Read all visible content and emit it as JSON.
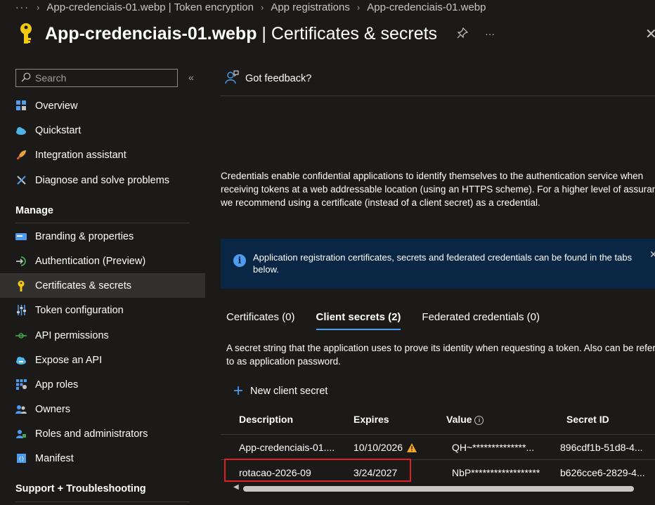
{
  "breadcrumb": {
    "more": "···",
    "items": [
      "App-credenciais-01.webp | Token encryption",
      "App registrations",
      "App-credenciais-01.webp"
    ]
  },
  "header": {
    "title_strong": "App-credenciais-01.webp",
    "title_rest": " | Certificates & secrets",
    "more": "···"
  },
  "sidebar": {
    "search_placeholder": "Search",
    "collapse": "«",
    "items_top": [
      {
        "label": "Overview",
        "icon": "overview-grid-icon"
      },
      {
        "label": "Quickstart",
        "icon": "cloud-quickstart-icon"
      },
      {
        "label": "Integration assistant",
        "icon": "rocket-icon"
      },
      {
        "label": "Diagnose and solve problems",
        "icon": "wrench-icon"
      }
    ],
    "manage_header": "Manage",
    "manage_items": [
      {
        "label": "Branding & properties",
        "icon": "branding-card-icon"
      },
      {
        "label": "Authentication (Preview)",
        "icon": "authentication-icon"
      },
      {
        "label": "Certificates & secrets",
        "icon": "key-icon"
      },
      {
        "label": "Token configuration",
        "icon": "sliders-icon"
      },
      {
        "label": "API permissions",
        "icon": "api-permissions-icon"
      },
      {
        "label": "Expose an API",
        "icon": "cloud-api-icon"
      },
      {
        "label": "App roles",
        "icon": "app-roles-grid-icon"
      },
      {
        "label": "Owners",
        "icon": "owners-people-icon"
      },
      {
        "label": "Roles and administrators",
        "icon": "roles-admins-icon"
      },
      {
        "label": "Manifest",
        "icon": "manifest-icon"
      }
    ],
    "support_header": "Support + Troubleshooting"
  },
  "main": {
    "feedback": "Got feedback?",
    "description": "Credentials enable confidential applications to identify themselves to the authentication service when receiving tokens at a web addressable location (using an HTTPS scheme). For a higher level of assurance, we recommend using a certificate (instead of a client secret) as a credential.",
    "info_banner": "Application registration certificates, secrets and federated credentials can be found in the tabs below.",
    "tabs": [
      "Certificates (0)",
      "Client secrets (2)",
      "Federated credentials (0)"
    ],
    "secret_description": "A secret string that the application uses to prove its identity when requesting a token. Also can be referred to as application password.",
    "new_secret": "New client secret",
    "table": {
      "headers": [
        "Description",
        "Expires",
        "Value",
        "Secret ID"
      ],
      "rows": [
        {
          "description": "App-credenciais-01....",
          "expires": "10/10/2026",
          "warning": true,
          "value": "QH~**************...",
          "secret_id": "896cdf1b-51d8-4..."
        },
        {
          "description": "rotacao-2026-09",
          "expires": "3/24/2027",
          "warning": false,
          "value": "NbP******************",
          "secret_id": "b626cce6-2829-4..."
        }
      ]
    }
  },
  "colors": {
    "background": "#1b1a19",
    "accent": "#4f9bee",
    "info_banner_bg": "#0a2645",
    "highlight": "#e02020",
    "warning": "#f7a823"
  }
}
